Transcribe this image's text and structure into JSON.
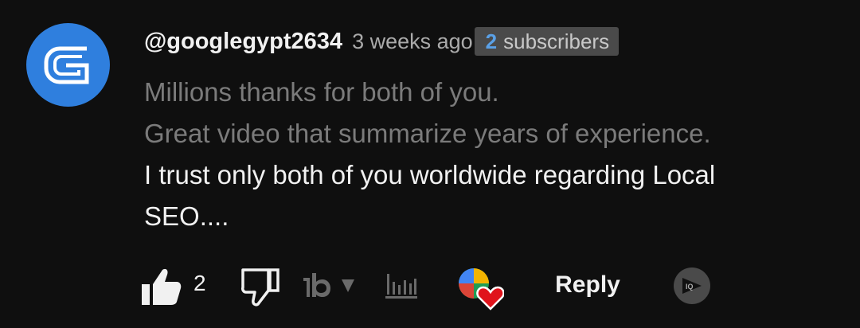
{
  "comment": {
    "author": "@googlegypt2634",
    "time": "3 weeks ago",
    "subscriber_count": "2",
    "subscriber_label": "subscribers",
    "lines": [
      "Millions thanks for both of you.",
      "Great video that summarize years of experience.",
      "I trust only both of you worldwide regarding Local",
      "SEO...."
    ]
  },
  "actions": {
    "like_count": "2",
    "reply_label": "Reply"
  },
  "icons": {
    "avatar": "g-logo-avatar",
    "like": "thumbs-up-icon",
    "dislike": "thumbs-down-icon",
    "tubebuddy": "tubebuddy-icon",
    "stats": "bar-stats-icon",
    "heart": "creator-heart-icon",
    "vidiq": "vidiq-icon"
  },
  "colors": {
    "background": "#0f0f0f",
    "avatar": "#2f7fde",
    "subscriber_count": "#5aa0e6",
    "heart": "#e0131b"
  }
}
